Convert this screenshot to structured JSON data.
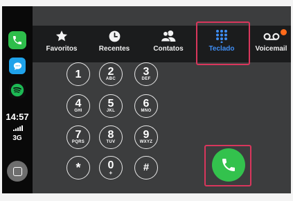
{
  "sidebar": {
    "apps": [
      {
        "name": "phone",
        "icon": "phone-icon",
        "color": "#2ebe4b"
      },
      {
        "name": "messages",
        "icon": "message-bubble-icon",
        "color": "#1fa2ea"
      },
      {
        "name": "spotify",
        "icon": "spotify-icon",
        "color": "#1db954"
      }
    ],
    "time": "14:57",
    "network": "3G",
    "home_icon": "home-square-icon"
  },
  "tabs": [
    {
      "label": "Favoritos",
      "icon": "star-icon"
    },
    {
      "label": "Recentes",
      "icon": "clock-icon"
    },
    {
      "label": "Contatos",
      "icon": "contacts-icon"
    },
    {
      "label": "Teclado",
      "icon": "keypad-icon",
      "selected": true
    },
    {
      "label": "Voicemail",
      "icon": "voicemail-icon",
      "badge_color": "#ff6a1a"
    }
  ],
  "keypad": {
    "keys": [
      {
        "digit": "1",
        "letters": ""
      },
      {
        "digit": "2",
        "letters": "ABC"
      },
      {
        "digit": "3",
        "letters": "DEF"
      },
      {
        "digit": "4",
        "letters": "GHI"
      },
      {
        "digit": "5",
        "letters": "JKL"
      },
      {
        "digit": "6",
        "letters": "MNO"
      },
      {
        "digit": "7",
        "letters": "PQRS"
      },
      {
        "digit": "8",
        "letters": "TUV"
      },
      {
        "digit": "9",
        "letters": "WXYZ"
      },
      {
        "digit": "*",
        "letters": ""
      },
      {
        "digit": "0",
        "letters": "+"
      },
      {
        "digit": "#",
        "letters": ""
      }
    ]
  },
  "call_button": {
    "icon": "phone-call-icon",
    "color": "#33c24d"
  },
  "colors": {
    "accent": "#3f8ef5",
    "highlight": "#d9365c",
    "background": "#3c3d3e",
    "tabbar": "#1b1c1d"
  }
}
